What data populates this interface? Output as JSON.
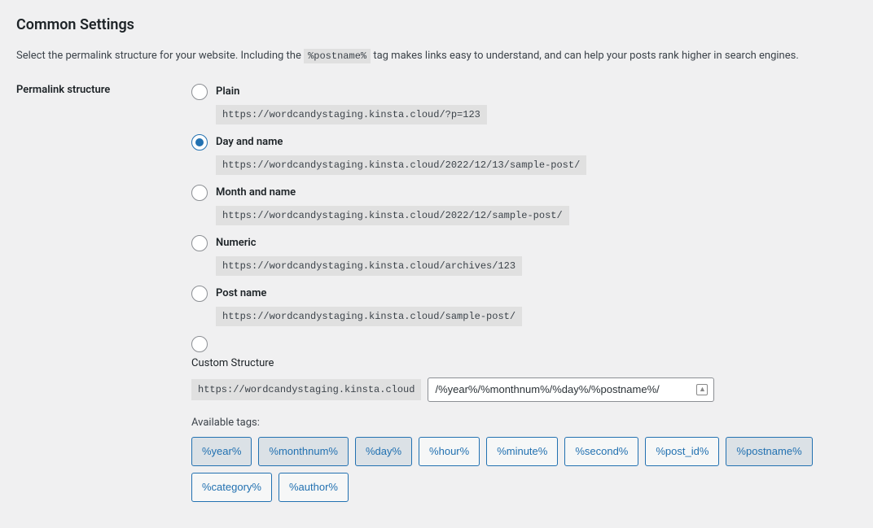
{
  "heading": "Common Settings",
  "description_pre": "Select the permalink structure for your website. Including the ",
  "description_code": "%postname%",
  "description_post": " tag makes links easy to understand, and can help your posts rank higher in search engines.",
  "form_label": "Permalink structure",
  "base_url": "https://wordcandystaging.kinsta.cloud",
  "options": {
    "plain": {
      "label": "Plain",
      "example": "https://wordcandystaging.kinsta.cloud/?p=123"
    },
    "day_name": {
      "label": "Day and name",
      "example": "https://wordcandystaging.kinsta.cloud/2022/12/13/sample-post/"
    },
    "month_name": {
      "label": "Month and name",
      "example": "https://wordcandystaging.kinsta.cloud/2022/12/sample-post/"
    },
    "numeric": {
      "label": "Numeric",
      "example": "https://wordcandystaging.kinsta.cloud/archives/123"
    },
    "post_name": {
      "label": "Post name",
      "example": "https://wordcandystaging.kinsta.cloud/sample-post/"
    },
    "custom": {
      "label": "Custom Structure",
      "value": "/%year%/%monthnum%/%day%/%postname%/"
    }
  },
  "available_tags_label": "Available tags:",
  "tags": [
    "%year%",
    "%monthnum%",
    "%day%",
    "%hour%",
    "%minute%",
    "%second%",
    "%post_id%",
    "%postname%",
    "%category%",
    "%author%"
  ],
  "active_tags": [
    "%year%",
    "%monthnum%",
    "%day%",
    "%postname%"
  ]
}
